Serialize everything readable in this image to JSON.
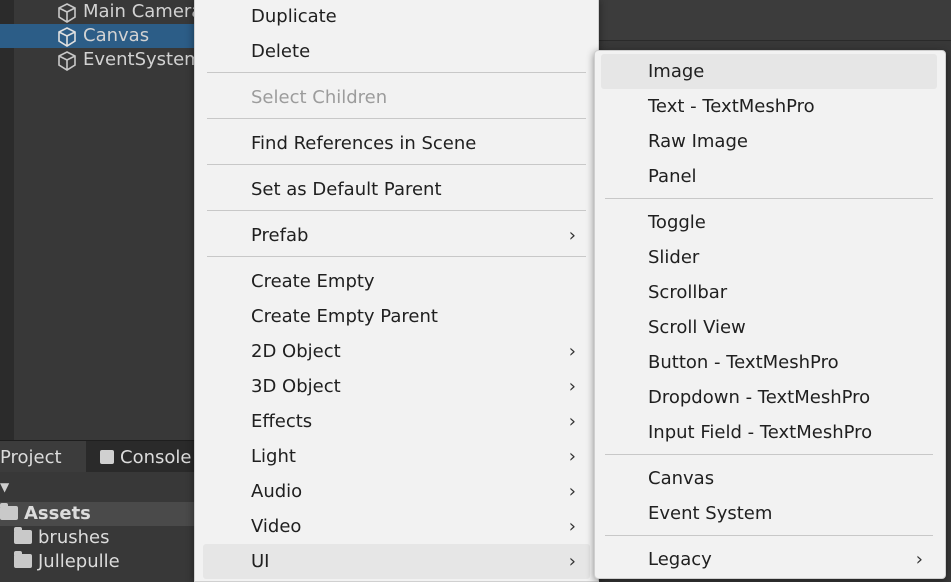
{
  "hierarchy": {
    "items": [
      {
        "label": "Main Camera"
      },
      {
        "label": "Canvas"
      },
      {
        "label": "EventSystem"
      }
    ]
  },
  "project_panel": {
    "tabs": [
      {
        "label": "Project"
      },
      {
        "label": "Console"
      }
    ],
    "dropdown_glyph": "▼",
    "tree": [
      {
        "label": "Assets"
      },
      {
        "label": "brushes"
      },
      {
        "label": "Jullepulle"
      }
    ]
  },
  "context_menu": {
    "items": [
      {
        "label": "Duplicate"
      },
      {
        "label": "Delete"
      },
      {
        "label": "Select Children",
        "disabled": true
      },
      {
        "label": "Find References in Scene"
      },
      {
        "label": "Set as Default Parent"
      },
      {
        "label": "Prefab",
        "submenu": true
      },
      {
        "label": "Create Empty"
      },
      {
        "label": "Create Empty Parent"
      },
      {
        "label": "2D Object",
        "submenu": true
      },
      {
        "label": "3D Object",
        "submenu": true
      },
      {
        "label": "Effects",
        "submenu": true
      },
      {
        "label": "Light",
        "submenu": true
      },
      {
        "label": "Audio",
        "submenu": true
      },
      {
        "label": "Video",
        "submenu": true
      },
      {
        "label": "UI",
        "submenu": true,
        "active": true
      }
    ]
  },
  "ui_submenu": {
    "items": [
      {
        "label": "Image",
        "highlighted": true
      },
      {
        "label": "Text - TextMeshPro"
      },
      {
        "label": "Raw Image"
      },
      {
        "label": "Panel"
      },
      {
        "label": "Toggle"
      },
      {
        "label": "Slider"
      },
      {
        "label": "Scrollbar"
      },
      {
        "label": "Scroll View"
      },
      {
        "label": "Button - TextMeshPro"
      },
      {
        "label": "Dropdown - TextMeshPro"
      },
      {
        "label": "Input Field - TextMeshPro"
      },
      {
        "label": "Canvas"
      },
      {
        "label": "Event System"
      },
      {
        "label": "Legacy",
        "submenu": true
      }
    ]
  },
  "glyphs": {
    "submenu_arrow": "›"
  },
  "colors": {
    "editor_bg": "#383838",
    "selection_blue": "#2c5d87",
    "menu_bg": "#f2f2f2",
    "menu_hover": "#e6e6e6",
    "disabled_text": "#9c9c9c"
  }
}
